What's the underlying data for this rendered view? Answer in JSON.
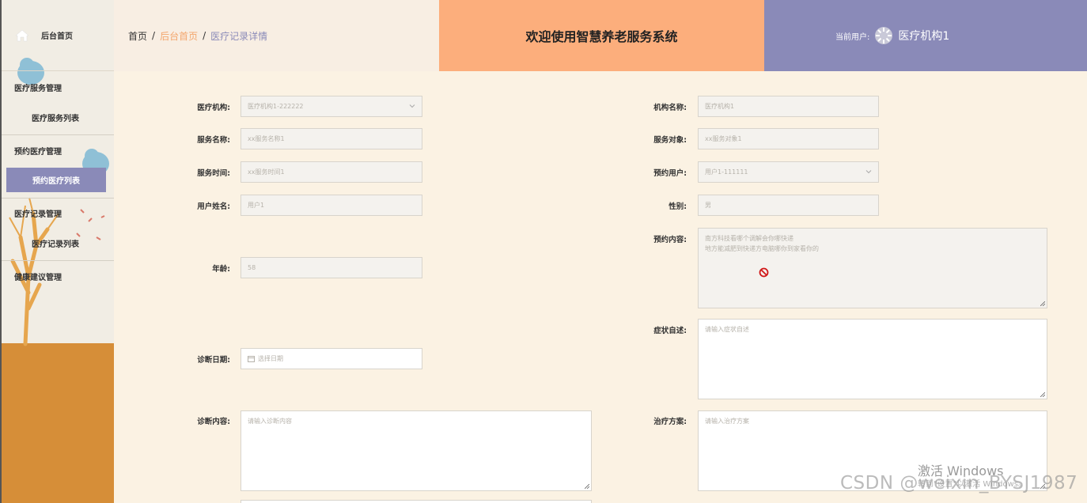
{
  "sidebar": {
    "home_label": "后台首页",
    "items": [
      {
        "label": "医疗服务管理"
      },
      {
        "label": "医疗服务列表"
      },
      {
        "label": "预约医疗管理"
      },
      {
        "label": "预约医疗列表"
      },
      {
        "label": "医疗记录管理"
      },
      {
        "label": "医疗记录列表"
      },
      {
        "label": "健康建议管理"
      }
    ]
  },
  "header": {
    "breadcrumb": [
      "首页",
      "后台首页",
      "医疗记录详情"
    ],
    "separator": "/",
    "title": "欢迎使用智慧养老服务系统",
    "user_label": "当前用户:",
    "user_name": "医疗机构1"
  },
  "form": {
    "yiliao_jigou": {
      "label": "医疗机构:",
      "value": "医疗机构1-222222"
    },
    "fuwu_mingcheng": {
      "label": "服务名称:",
      "value": "xx服务名称1"
    },
    "fuwu_shijian": {
      "label": "服务时间:",
      "value": "xx服务时间1"
    },
    "yonghu_xingming": {
      "label": "用户姓名:",
      "value": "用户1"
    },
    "nianling": {
      "label": "年龄:",
      "value": "58"
    },
    "zhenduan_riqi": {
      "label": "诊断日期:",
      "placeholder": "选择日期"
    },
    "zhenduan_neirong": {
      "label": "诊断内容:",
      "placeholder": "请输入诊断内容"
    },
    "jigou_mingcheng": {
      "label": "机构名称:",
      "value": "医疗机构1"
    },
    "fuwu_duixiang": {
      "label": "服务对象:",
      "value": "xx服务对象1"
    },
    "yuyue_yonghu": {
      "label": "预约用户:",
      "value": "用户1-111111"
    },
    "xingbie": {
      "label": "性别:",
      "value": "男"
    },
    "yuyue_neirong": {
      "label": "预约内容:",
      "line1": "南方科技看哪个调解会你哪快递",
      "line2": "地方能减肥到快递方电脑哪你到家看你的"
    },
    "zhengzhuang_zishu": {
      "label": "症状自述:",
      "placeholder": "请输入症状自述"
    },
    "zhiliao_fangan": {
      "label": "治疗方案:",
      "placeholder": "请输入治疗方案"
    }
  },
  "watermarks": {
    "windows_line1": "激活 Windows",
    "windows_line2": "转到\"设置\"以激活 Windows。",
    "csdn": "CSDN @weixin_BYSJ1987"
  },
  "colors": {
    "accent_purple": "#8a8ab8",
    "accent_orange": "#fcae7c",
    "background": "#fbf2e3"
  }
}
